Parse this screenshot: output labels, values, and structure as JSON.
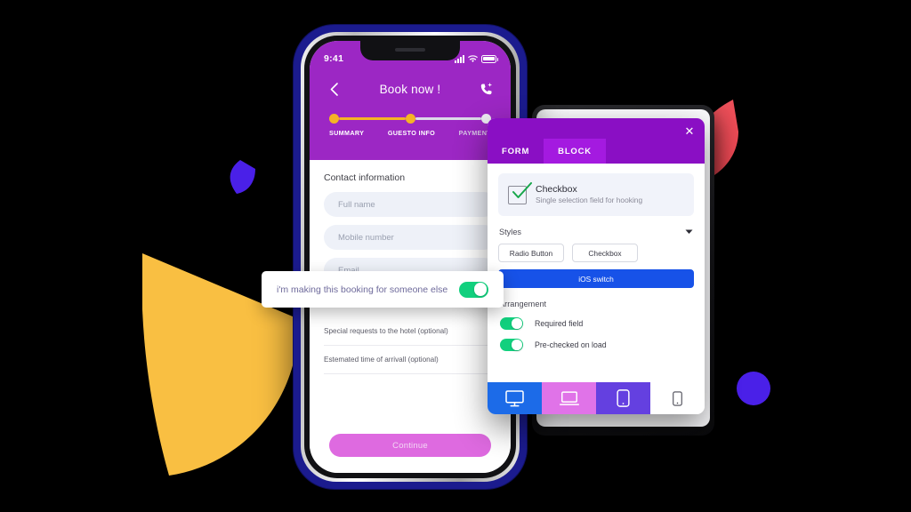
{
  "phone": {
    "status_bar": {
      "time": "9:41",
      "signal_icon": "signal-bars-icon",
      "wifi_icon": "wifi-icon",
      "battery_icon": "battery-icon"
    },
    "nav": {
      "back_icon": "chevron-left-icon",
      "title": "Book now !",
      "call_icon": "phone-add-icon"
    },
    "stepper": {
      "steps": [
        {
          "label": "SUMMARY",
          "state": "done"
        },
        {
          "label": "GUESTO INFO",
          "state": "done"
        },
        {
          "label": "PAYMENT",
          "state": "todo"
        }
      ],
      "done_color": "#F5B425",
      "todo_color": "#DCDAE8"
    },
    "form": {
      "section_title": "Contact information",
      "fields": [
        {
          "placeholder": "Full name"
        },
        {
          "placeholder": "Mobile number"
        },
        {
          "placeholder": "Email"
        }
      ],
      "selects": [
        {
          "label": "Special requests to the hotel (optional)"
        },
        {
          "label": "Estemated time of arrivall (optional)"
        }
      ],
      "submit_label": "Continue"
    }
  },
  "toggle_card": {
    "label": "i'm making this booking for someone else",
    "switch_on": true,
    "switch_color": "#12D07E"
  },
  "panel": {
    "close_icon": "close-icon",
    "header_color": "#8A0FC4",
    "tabs": [
      {
        "label": "FORM",
        "active": false
      },
      {
        "label": "BLOCK",
        "active": true
      }
    ],
    "type_card": {
      "icon": "checkbox-checked-icon",
      "name": "Checkbox",
      "description": "Single selection field for hooking"
    },
    "styles": {
      "section_label": "Styles",
      "collapse_icon": "chevron-down-icon",
      "options": [
        {
          "label": "Radio Button",
          "selected": false
        },
        {
          "label": "Checkbox",
          "selected": false
        },
        {
          "label": "iOS switch",
          "selected": true
        }
      ],
      "selected_color": "#1752E8"
    },
    "arrangement": {
      "section_label": "Arrangement",
      "toggles": [
        {
          "label": "Required field",
          "on": true
        },
        {
          "label": "Pre-checked on load",
          "on": true
        }
      ]
    },
    "device_bar": [
      {
        "icon": "desktop-icon",
        "color": "#1C6BE8",
        "active": true
      },
      {
        "icon": "laptop-icon",
        "color": "#E073E8",
        "active": false
      },
      {
        "icon": "tablet-icon",
        "color": "#6440E0",
        "active": false
      },
      {
        "icon": "mobile-icon",
        "color": "#FFFFFF",
        "active": false
      }
    ]
  },
  "decor": {
    "yellow_wedge_color": "#F9BF42",
    "blue_wedge_color": "#4A20E8",
    "red_wedge_color": "#F0555E",
    "purple_dot_color": "#4A20E8",
    "phone_shell_color": "#1B1B8E",
    "phone_header_color": "#9C27C4"
  }
}
